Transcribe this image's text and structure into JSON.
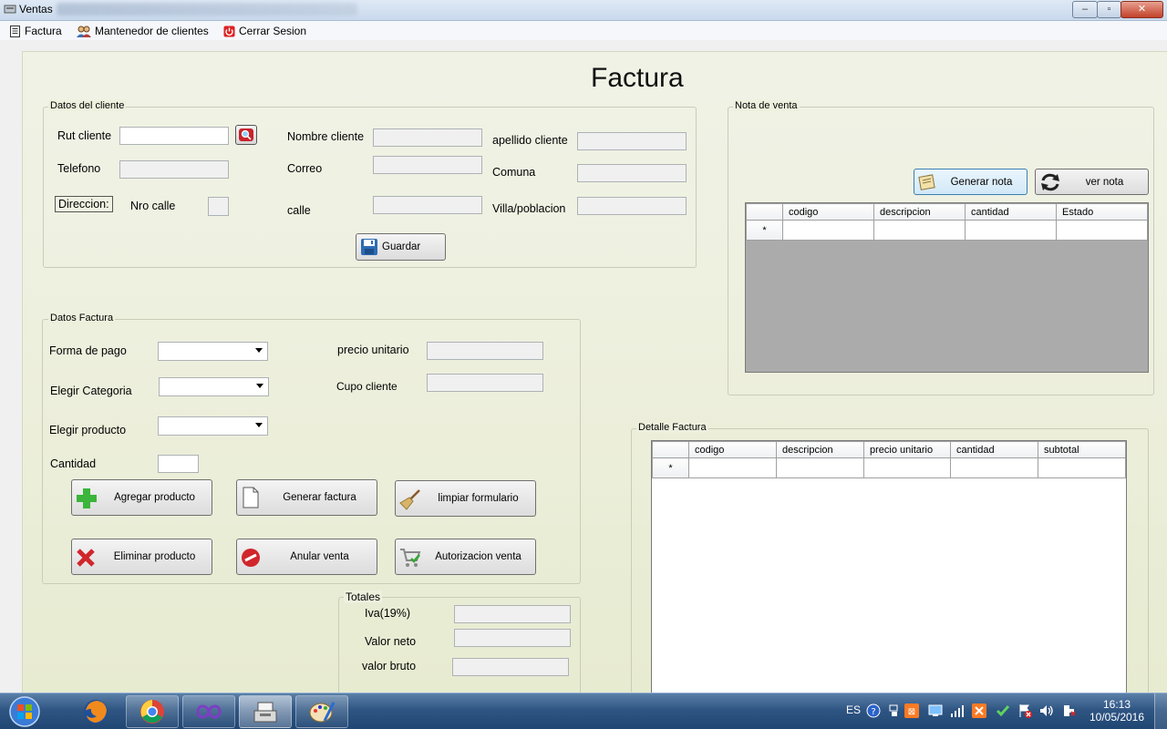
{
  "window": {
    "title": "Ventas",
    "buttons": {
      "minimize": "–",
      "maximize": "▫",
      "close": "✕"
    }
  },
  "menu": {
    "items": [
      {
        "label": "Factura",
        "icon": "invoice-icon"
      },
      {
        "label": "Mantenedor de clientes",
        "icon": "users-icon"
      },
      {
        "label": "Cerrar Sesion",
        "icon": "power-icon"
      }
    ]
  },
  "form": {
    "title": "Factura"
  },
  "cliente": {
    "legend": "Datos del cliente",
    "rut_label": "Rut cliente",
    "rut_value": "",
    "telefono_label": "Telefono",
    "direccion_label": "Direccion:",
    "nro_calle_label": "Nro calle",
    "nombre_label": "Nombre cliente",
    "correo_label": "Correo",
    "calle_label": "calle",
    "apellido_label": "apellido cliente",
    "comuna_label": "Comuna",
    "villa_label": "Villa/poblacion",
    "guardar_label": "Guardar"
  },
  "nota": {
    "legend": "Nota de venta",
    "generar_label": "Generar nota",
    "ver_label": "ver nota",
    "grid": {
      "row_marker": "*",
      "columns": [
        "codigo",
        "descripcion",
        "cantidad",
        "Estado"
      ]
    }
  },
  "factura": {
    "legend": "Datos Factura",
    "forma_pago_label": "Forma de pago",
    "categoria_label": "Elegir Categoria",
    "producto_label": "Elegir producto",
    "cantidad_label": "Cantidad",
    "precio_label": "precio unitario",
    "cupo_label": "Cupo cliente",
    "buttons": {
      "agregar": "Agregar producto",
      "generar": "Generar factura",
      "limpiar": "limpiar formulario",
      "eliminar": "Eliminar producto",
      "anular": "Anular venta",
      "autorizacion": "Autorizacion  venta"
    }
  },
  "totales": {
    "legend": "Totales",
    "iva_label": "Iva(19%)",
    "neto_label": "Valor neto",
    "bruto_label": "valor bruto"
  },
  "detalle": {
    "legend": "Detalle Factura",
    "grid": {
      "row_marker": "*",
      "columns": [
        "codigo",
        "descripcion",
        "precio unitario",
        "cantidad",
        "subtotal"
      ]
    }
  },
  "taskbar": {
    "lang": "ES",
    "time": "16:13",
    "date": "10/05/2016",
    "apps": [
      "firefox-icon",
      "chrome-icon",
      "visual-studio-icon",
      "cash-register-icon",
      "paint-icon"
    ]
  }
}
